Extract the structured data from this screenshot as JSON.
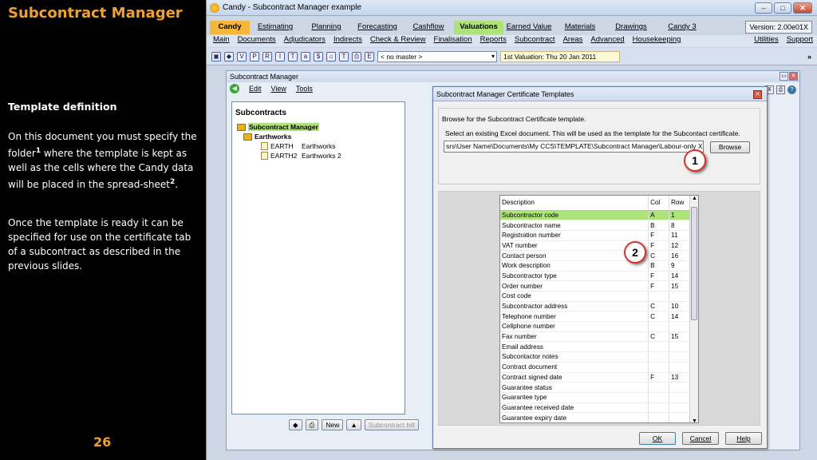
{
  "slide": {
    "title": "Subcontract Manager",
    "heading": "Template definition",
    "para1_a": "On this document you must specify the folder",
    "para1_sup1": "1",
    "para1_b": " where the template is kept as well as the cells where the Candy data will be placed in the spread-sheet",
    "para1_sup2": "2",
    "para1_c": ".",
    "para2": "Once the template is ready it can be specified for use on the certificate tab of a subcontract as described in the previous slides.",
    "page_number": "26"
  },
  "app": {
    "title": "Candy - Subcontract Manager example",
    "version": "Version: 2.00e01X",
    "tabs": [
      "Candy",
      "Estimating",
      "Planning",
      "Forecasting",
      "Cashflow",
      "Valuations",
      "Earned Value",
      "Materials",
      "Drawings",
      "Candy 3"
    ],
    "active_tab": "Valuations",
    "menu": [
      "Main",
      "Documents",
      "Adjudicators",
      "Indirects",
      "Check & Review",
      "Finalisation",
      "Reports",
      "Subcontract",
      "Areas",
      "Advanced",
      "Housekeeping"
    ],
    "menu_right": [
      "Utilities",
      "Support"
    ],
    "toolbar_select": "< no master >",
    "toolbar_valuation": "1st Valuation: Thu 20 Jan 2011"
  },
  "inner_window": {
    "title": "Subcontract Manager",
    "menu": [
      "Edit",
      "View",
      "Tools"
    ],
    "tree_heading": "Subcontracts",
    "tree_root": "Subcontract Manager",
    "tree_group": "Earthworks",
    "tree_items": [
      {
        "code": "EARTH",
        "name": "Earthworks"
      },
      {
        "code": "EARTH2",
        "name": "Earthworks 2"
      }
    ],
    "bottom_new": "New",
    "bottom_bill": "Subcontract bill"
  },
  "dialog": {
    "title": "Subcontract Manager Certificate Templates",
    "browse_label": "Browse for the Subcontract Certificate template.",
    "browse_desc": "Select an existing Excel document. This will be used as the template for the Subcontact certificate.",
    "path": "srs\\User Name\\Documents\\My CCS\\TEMPLATE\\Subcontract Manager\\Labour-only XLS",
    "browse_button": "Browse",
    "callout1": "1",
    "callout2": "2",
    "columns": [
      "Description",
      "Col",
      "Row"
    ],
    "rows": [
      [
        "Subcontractor code",
        "A",
        "1"
      ],
      [
        "Subcontractor name",
        "B",
        "8"
      ],
      [
        "Registration number",
        "F",
        "11"
      ],
      [
        "VAT number",
        "F",
        "12"
      ],
      [
        "Contact person",
        "C",
        "16"
      ],
      [
        "Work description",
        "B",
        "9"
      ],
      [
        "Subcontractor type",
        "F",
        "14"
      ],
      [
        "Order number",
        "F",
        "15"
      ],
      [
        "Cost code",
        "",
        ""
      ],
      [
        "Subcontractor address",
        "C",
        "10"
      ],
      [
        "Telephone number",
        "C",
        "14"
      ],
      [
        "Cellphone number",
        "",
        ""
      ],
      [
        "Fax number",
        "C",
        "15"
      ],
      [
        "Email address",
        "",
        ""
      ],
      [
        "Subcontactor notes",
        "",
        ""
      ],
      [
        "Contract document",
        "",
        ""
      ],
      [
        "Contract signed date",
        "F",
        "13"
      ],
      [
        "Guarantee status",
        "",
        ""
      ],
      [
        "Guarantee type",
        "",
        ""
      ],
      [
        "Guarantee received date",
        "",
        ""
      ],
      [
        "Guarantee expiry date",
        "",
        ""
      ]
    ],
    "ok": "OK",
    "cancel": "Cancel",
    "help": "Help"
  },
  "colors": {
    "accent_orange": "#f0a030",
    "highlight_green": "#aee27a",
    "callout_red": "#d9322a"
  }
}
